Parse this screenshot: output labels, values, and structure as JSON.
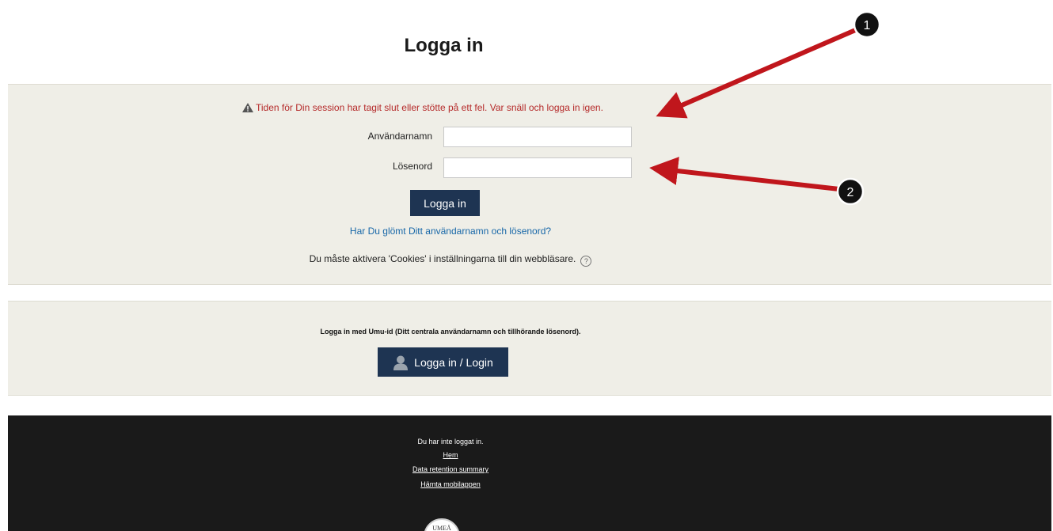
{
  "page": {
    "title": "Logga in"
  },
  "login": {
    "error_message": "Tiden för Din session har tagit slut eller stötte på ett fel. Var snäll och logga in igen.",
    "username_label": "Användarnamn",
    "username_value": "",
    "password_label": "Lösenord",
    "password_value": "",
    "submit_label": "Logga in",
    "forgot_link": "Har Du glömt Ditt användarnamn och lösenord?",
    "cookies_notice": "Du måste aktivera 'Cookies' i inställningarna till din webbläsare."
  },
  "umu": {
    "description": "Logga in med Umu-id (Ditt centrala användarnamn och tillhörande lösenord).",
    "button_label": "Logga in / Login"
  },
  "footer": {
    "status": "Du har inte loggat in.",
    "home_link": "Hem",
    "retention_link": "Data retention summary",
    "mobile_link": "Hämta mobilappen",
    "seal_text": "UMEÅ"
  },
  "annotations": [
    {
      "label": "1"
    },
    {
      "label": "2"
    }
  ],
  "colors": {
    "error": "#b52a2a",
    "link": "#1767a8",
    "button": "#1e3452",
    "panel": "#efeee7",
    "footer": "#1a1a1a",
    "arrow": "#c0161c"
  },
  "icons": [
    "warning-icon",
    "help-icon",
    "user-icon",
    "university-seal"
  ]
}
